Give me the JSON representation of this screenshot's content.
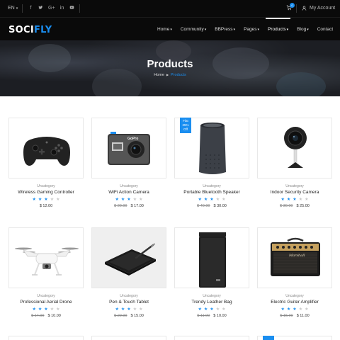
{
  "topbar": {
    "language": "EN",
    "social_icons": [
      "facebook-icon",
      "twitter-icon",
      "google-plus-icon",
      "linkedin-icon",
      "youtube-icon"
    ],
    "cart_count": "0",
    "account_label": "My Account"
  },
  "brand": {
    "part1": "SOCI",
    "part2": "FLY",
    "accent": "#1a8ef0"
  },
  "nav": [
    {
      "label": "Home",
      "caret": true
    },
    {
      "label": "Community",
      "caret": true
    },
    {
      "label": "BBPress",
      "caret": true
    },
    {
      "label": "Pages",
      "caret": true
    },
    {
      "label": "Products",
      "caret": true,
      "active": true
    },
    {
      "label": "Blog",
      "caret": true
    },
    {
      "label": "Contact",
      "caret": false
    }
  ],
  "hero": {
    "title": "Products",
    "breadcrumb": {
      "home": "Home",
      "current": "Products"
    }
  },
  "products": [
    {
      "category": "Uncategory",
      "name": "Wireless Gaming Controller",
      "rating": 3,
      "old_price": "",
      "price": "$ 12.00",
      "sale": false,
      "icon": "gamepad-icon"
    },
    {
      "category": "Uncategory",
      "name": "WiFi Action Camera",
      "rating": 3,
      "old_price": "$ 20.00",
      "price": "$ 17.00",
      "sale": false,
      "icon": "action-camera-icon"
    },
    {
      "category": "Uncategory",
      "name": "Portable Bluetooth Speaker",
      "rating": 3,
      "old_price": "$ 40.00",
      "price": "$ 30.00",
      "sale": true,
      "sale_text": "Flat 25% Off",
      "icon": "speaker-icon"
    },
    {
      "category": "Uncategory",
      "name": "Indoor Security Camera",
      "rating": 3,
      "old_price": "$ 30.00",
      "price": "$ 25.00",
      "sale": false,
      "icon": "security-camera-icon"
    },
    {
      "category": "Uncategory",
      "name": "Professional Aerial Drone",
      "rating": 3,
      "old_price": "$ 14.00",
      "price": "$ 10.00",
      "sale": false,
      "icon": "drone-icon"
    },
    {
      "category": "Uncategory",
      "name": "Pen & Touch Tablet",
      "rating": 3,
      "old_price": "$ 20.00",
      "price": "$ 15.00",
      "sale": false,
      "icon": "drawing-tablet-icon"
    },
    {
      "category": "Uncategory",
      "name": "Trendy Leather Bag",
      "rating": 3,
      "old_price": "$ 11.00",
      "price": "$ 10.00",
      "sale": false,
      "icon": "leather-bag-icon"
    },
    {
      "category": "Uncategory",
      "name": "Electric Guiter Amplifier",
      "rating": 3,
      "old_price": "$ 15.00",
      "price": "$ 11.00",
      "sale": false,
      "icon": "amplifier-icon"
    }
  ]
}
